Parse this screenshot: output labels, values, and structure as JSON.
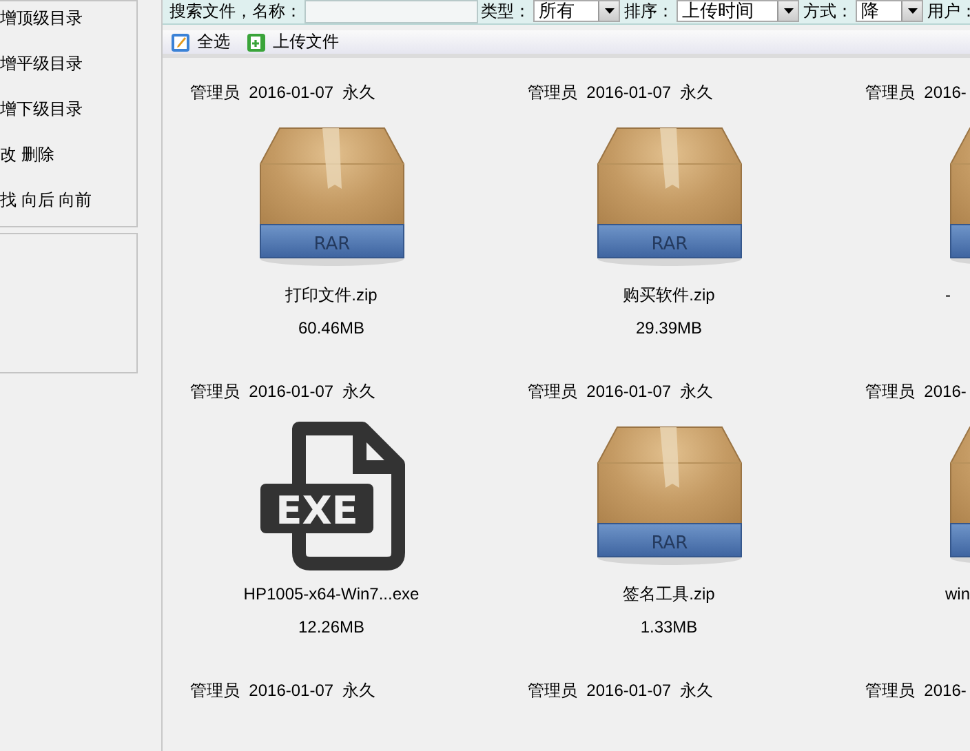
{
  "sidebar": {
    "menu_items": [
      "增顶级目录",
      "增平级目录",
      "增下级目录",
      "改 删除",
      "找 向后 向前"
    ]
  },
  "search_bar": {
    "name_label": "搜索文件，名称：",
    "type_label": "类型：",
    "type_value": "所有",
    "sort_label": "排序：",
    "sort_value": "上传时间",
    "order_label": "方式：",
    "order_value": "降",
    "user_label": "用户："
  },
  "toolbar": {
    "buttons": [
      {
        "kind": "select",
        "label": "全选"
      },
      {
        "kind": "upload",
        "label": "上传文件"
      }
    ]
  },
  "files": [
    {
      "owner": "管理员",
      "date": "2016-01-07",
      "expiry": "永久",
      "kind": "rar",
      "icon_label": "RAR",
      "name": "打印文件.zip",
      "size": "60.46MB"
    },
    {
      "owner": "管理员",
      "date": "2016-01-07",
      "expiry": "永久",
      "kind": "rar",
      "icon_label": "RAR",
      "name": "购买软件.zip",
      "size": "29.39MB"
    },
    {
      "owner": "管理员",
      "date": "2016-",
      "kind": "rar",
      "name": "-"
    },
    {
      "owner": "管理员",
      "date": "2016-01-07",
      "expiry": "永久",
      "kind": "exe",
      "icon_label": "EXE",
      "name": "HP1005-x64-Win7...exe",
      "size": "12.26MB"
    },
    {
      "owner": "管理员",
      "date": "2016-01-07",
      "expiry": "永久",
      "kind": "rar",
      "icon_label": "RAR",
      "name": "签名工具.zip",
      "size": "1.33MB"
    },
    {
      "owner": "管理员",
      "date": "2016-",
      "kind": "rar",
      "name": "win"
    },
    {
      "owner": "管理员",
      "date": "2016-01-07",
      "expiry": "永久",
      "kind": "none"
    },
    {
      "owner": "管理员",
      "date": "2016-01-07",
      "expiry": "永久",
      "kind": "none"
    },
    {
      "owner": "管理员",
      "date": "2016-",
      "kind": "none"
    }
  ]
}
